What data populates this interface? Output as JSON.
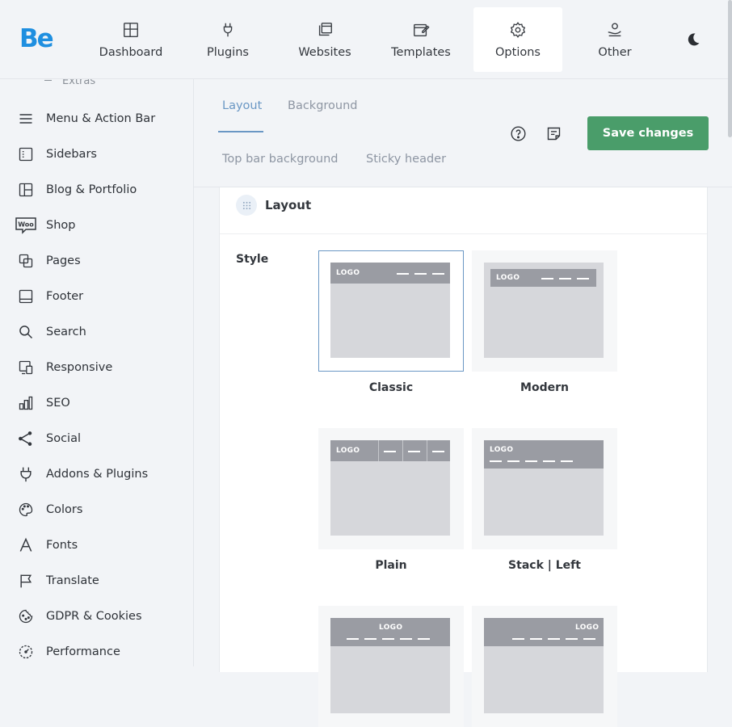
{
  "app": {
    "logo_text": "Be",
    "brand_color": "#1f8fe0"
  },
  "top_nav": {
    "items": [
      {
        "label": "Dashboard",
        "icon": "dashboard-icon"
      },
      {
        "label": "Plugins",
        "icon": "plug-icon"
      },
      {
        "label": "Websites",
        "icon": "websites-icon"
      },
      {
        "label": "Templates",
        "icon": "templates-icon"
      },
      {
        "label": "Options",
        "icon": "gear-icon",
        "active": true
      },
      {
        "label": "Other",
        "icon": "user-hand-icon"
      }
    ],
    "theme_toggle_icon": "moon-icon"
  },
  "sidebar": {
    "partial_item": "Extras",
    "items": [
      {
        "label": "Menu & Action Bar",
        "icon": "menu-icon"
      },
      {
        "label": "Sidebars",
        "icon": "sidebar-icon"
      },
      {
        "label": "Blog & Portfolio",
        "icon": "blog-icon"
      },
      {
        "label": "Shop",
        "icon": "woo-icon"
      },
      {
        "label": "Pages",
        "icon": "pages-icon"
      },
      {
        "label": "Footer",
        "icon": "footer-icon"
      },
      {
        "label": "Search",
        "icon": "search-icon"
      },
      {
        "label": "Responsive",
        "icon": "responsive-icon"
      },
      {
        "label": "SEO",
        "icon": "seo-icon"
      },
      {
        "label": "Social",
        "icon": "share-icon"
      },
      {
        "label": "Addons & Plugins",
        "icon": "plug-icon"
      },
      {
        "label": "Colors",
        "icon": "palette-icon"
      },
      {
        "label": "Fonts",
        "icon": "font-icon"
      },
      {
        "label": "Translate",
        "icon": "flag-icon"
      },
      {
        "label": "GDPR & Cookies",
        "icon": "cookie-icon"
      },
      {
        "label": "Performance",
        "icon": "performance-icon"
      }
    ]
  },
  "subtabs": {
    "items": [
      {
        "label": "Layout",
        "active": true
      },
      {
        "label": "Background"
      },
      {
        "label": "Top bar background"
      },
      {
        "label": "Sticky header"
      }
    ],
    "help_icon": "help-icon",
    "notes_icon": "notes-icon",
    "save_label": "Save changes",
    "save_color": "#4a9d6a"
  },
  "panel": {
    "title": "Layout",
    "handle_icon": "drag-handle-icon",
    "style_label": "Style",
    "options": [
      {
        "caption": "Classic",
        "logo": "LOGO",
        "selected": true
      },
      {
        "caption": "Modern",
        "logo": "LOGO"
      },
      {
        "caption": "Plain",
        "logo": "LOGO"
      },
      {
        "caption": "Stack | Left",
        "logo": "LOGO"
      },
      {
        "caption": "",
        "logo": "LOGO"
      },
      {
        "caption": "",
        "logo": "LOGO"
      }
    ]
  }
}
